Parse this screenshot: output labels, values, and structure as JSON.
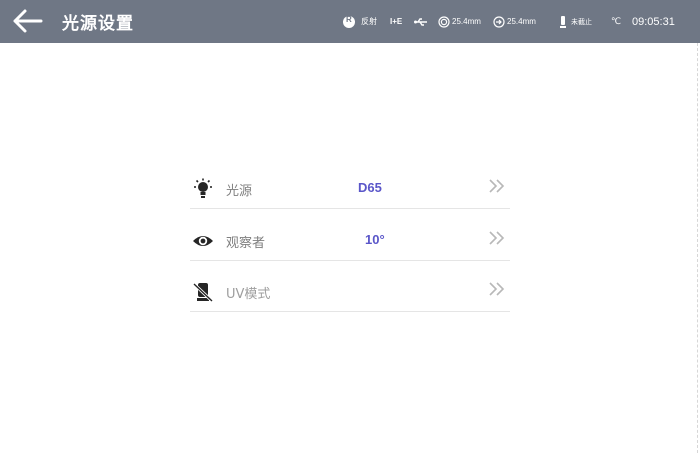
{
  "header": {
    "back_icon": "arrow-left-icon",
    "title": "光源设置",
    "mode_badge": "R",
    "mode_text": "反射",
    "ie_text": "I+E",
    "aperture_1": "25.4mm",
    "aperture_2": "25.4mm",
    "expiry_text": "未截止",
    "temp_unit": "℃",
    "time": "09:05:31"
  },
  "settings": {
    "rows": [
      {
        "icon": "light-bulb-icon",
        "label": "光源",
        "value": "D65",
        "disabled": false
      },
      {
        "icon": "eye-icon",
        "label": "观察者",
        "value": "10°",
        "disabled": false
      },
      {
        "icon": "uv-off-icon",
        "label": "UV模式",
        "value": "",
        "disabled": true
      }
    ]
  },
  "colors": {
    "header_bg": "#6f7785",
    "value_text": "#5a56c9",
    "chevron": "#b8b8b8",
    "divider": "#e5e5e5"
  }
}
